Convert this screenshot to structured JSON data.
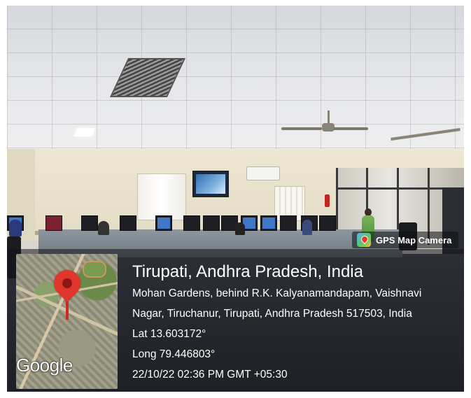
{
  "badge": {
    "label": "GPS Map Camera",
    "icon": "gps-map-camera-app-icon"
  },
  "map": {
    "provider_logo": "Google",
    "marker": "location-pin-icon"
  },
  "location": {
    "title": "Tirupati, Andhra Pradesh, India",
    "address_line1": "Mohan Gardens, behind R.K. Kalyanamandapam, Vaishnavi",
    "address_line2": "Nagar, Tiruchanur, Tirupati, Andhra Pradesh 517503, India",
    "latitude": "Lat 13.603172°",
    "longitude": "Long 79.446803°",
    "timestamp": "22/10/22 02:36 PM GMT +05:30"
  },
  "colors": {
    "pin": "#e0362c",
    "overlay_text": "#ffffff"
  }
}
